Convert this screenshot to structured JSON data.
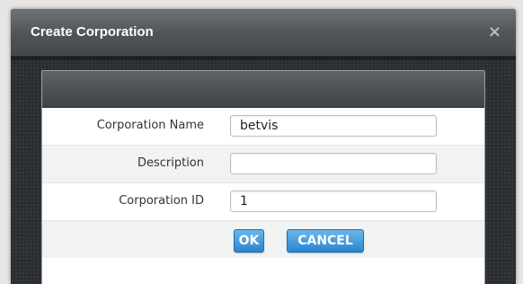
{
  "dialog": {
    "title": "Create Corporation",
    "close_glyph": "×"
  },
  "form": {
    "fields": [
      {
        "label": "Corporation Name",
        "value": "betvis"
      },
      {
        "label": "Description",
        "value": ""
      },
      {
        "label": "Corporation ID",
        "value": "1"
      }
    ],
    "ok_label": "OK",
    "cancel_label": "CANCEL"
  },
  "colors": {
    "button_blue": "#2a86cf",
    "titlebar_gray": "#4f5458",
    "dialog_dark": "#2a2d31"
  },
  "icons": {
    "close": "close-icon"
  }
}
